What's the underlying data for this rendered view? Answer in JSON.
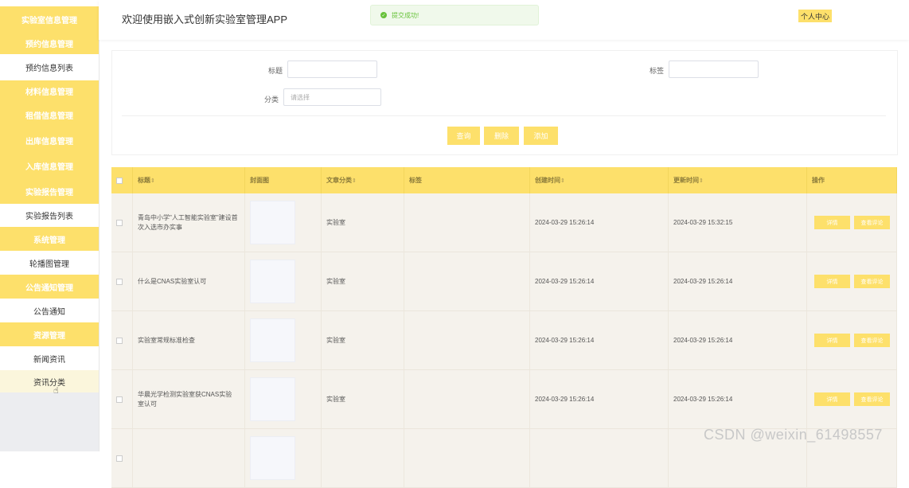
{
  "sidebar": {
    "items": [
      {
        "label": "",
        "type": "sub",
        "name": "sidebar-item-truncated"
      },
      {
        "label": "实验室信息管理",
        "type": "group",
        "name": "sidebar-group-lab-info"
      },
      {
        "label": "预约信息管理",
        "type": "group",
        "name": "sidebar-group-reservation"
      },
      {
        "label": "预约信息列表",
        "type": "sub",
        "name": "sidebar-item-reservation-list"
      },
      {
        "label": "材料信息管理",
        "type": "group",
        "name": "sidebar-group-material"
      },
      {
        "label": "租借信息管理",
        "type": "group",
        "name": "sidebar-group-rental"
      },
      {
        "label": "出库信息管理",
        "type": "group",
        "name": "sidebar-group-outbound"
      },
      {
        "label": "入库信息管理",
        "type": "group",
        "name": "sidebar-group-inbound"
      },
      {
        "label": "实验报告管理",
        "type": "group",
        "name": "sidebar-group-report"
      },
      {
        "label": "实验报告列表",
        "type": "sub",
        "name": "sidebar-item-report-list"
      },
      {
        "label": "系统管理",
        "type": "group",
        "name": "sidebar-group-system"
      },
      {
        "label": "轮播图管理",
        "type": "sub",
        "name": "sidebar-item-carousel"
      },
      {
        "label": "公告通知管理",
        "type": "group",
        "name": "sidebar-group-notice"
      },
      {
        "label": "公告通知",
        "type": "sub",
        "name": "sidebar-item-notice"
      },
      {
        "label": "资源管理",
        "type": "group",
        "name": "sidebar-group-resource"
      },
      {
        "label": "新闻资讯",
        "type": "sub",
        "name": "sidebar-item-news"
      },
      {
        "label": "资讯分类",
        "type": "active",
        "name": "sidebar-item-news-category"
      }
    ]
  },
  "header": {
    "title": "欢迎使用嵌入式创新实验室管理APP",
    "toast": "提交成功!",
    "user_center": "个人中心"
  },
  "search": {
    "title_label": "标题",
    "title_value": "",
    "tag_label": "标签",
    "tag_value": "",
    "category_label": "分类",
    "category_placeholder": "请选择",
    "query_button": "查询",
    "delete_button": "删除",
    "add_button": "添加"
  },
  "table": {
    "columns": [
      "标题",
      "封面图",
      "文章分类",
      "标签",
      "创建时间",
      "更新时间",
      "操作"
    ],
    "rows": [
      {
        "title": "青岛中小学\"人工智能实验室\"建设首次入选市办实事",
        "category": "实验室",
        "tag": "",
        "created": "2024-03-29 15:26:14",
        "updated": "2024-03-29 15:32:15"
      },
      {
        "title": "什么是CNAS实验室认可",
        "category": "实验室",
        "tag": "",
        "created": "2024-03-29 15:26:14",
        "updated": "2024-03-29 15:26:14"
      },
      {
        "title": "实验室常规标准检查",
        "category": "实验室",
        "tag": "",
        "created": "2024-03-29 15:26:14",
        "updated": "2024-03-29 15:26:14"
      },
      {
        "title": "华晨光学检测实验室获CNAS实验室认可",
        "category": "实验室",
        "tag": "",
        "created": "2024-03-29 15:26:14",
        "updated": "2024-03-29 15:26:14"
      },
      {
        "title": "",
        "category": "",
        "tag": "",
        "created": "",
        "updated": ""
      }
    ],
    "detail_button": "详情",
    "review_button": "查看评论"
  },
  "watermark": "CSDN @weixin_61498557",
  "colors": {
    "accent": "#fde06b",
    "sidebar_bg": "#ecedf0",
    "row_bg": "#f5f2ec",
    "toast_text": "#67c23a"
  }
}
